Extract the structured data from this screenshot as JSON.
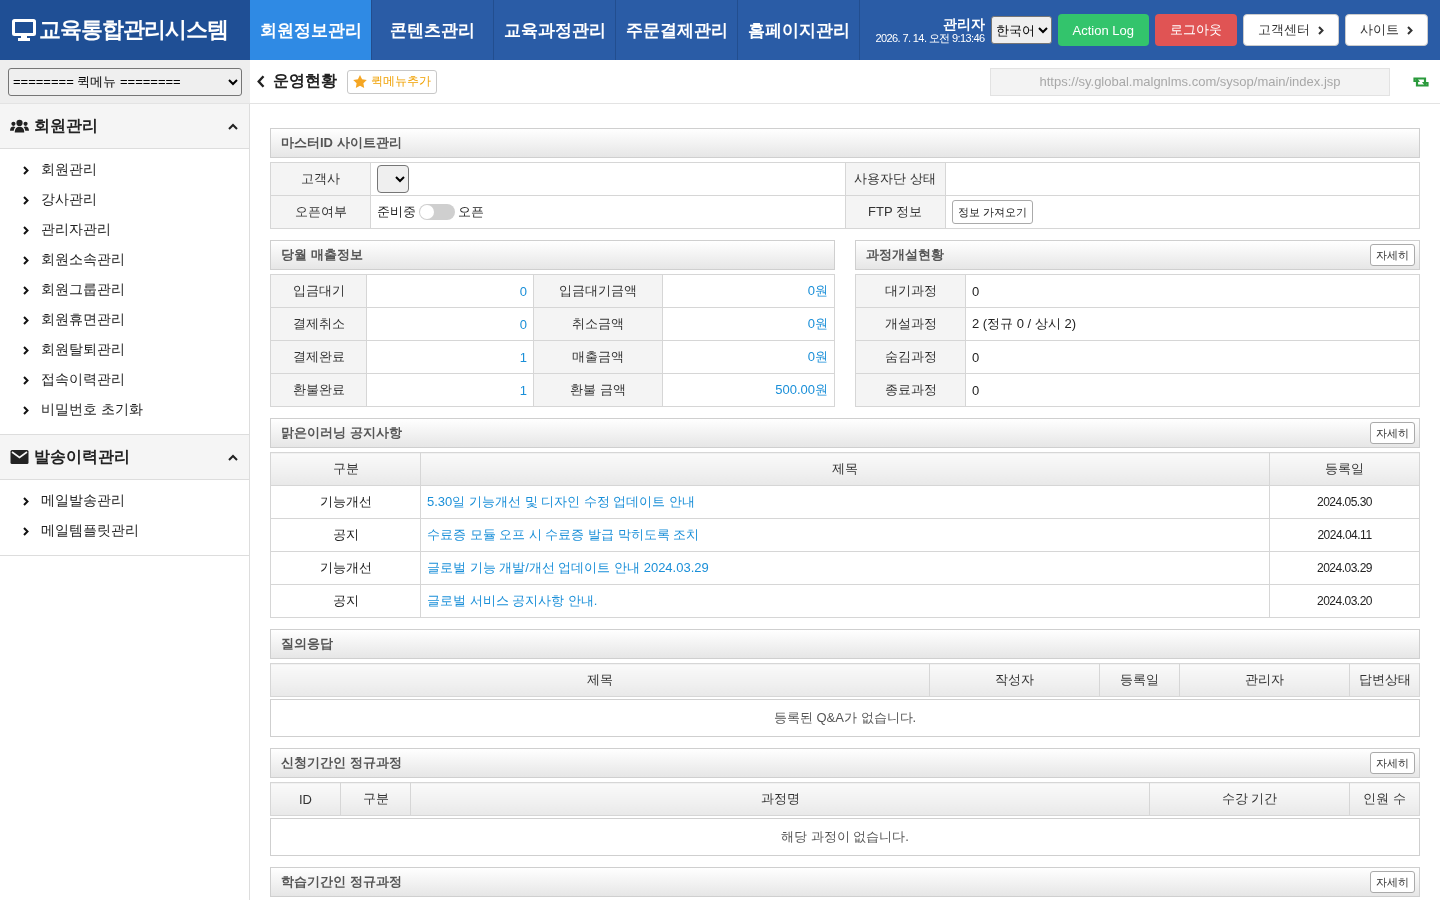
{
  "header": {
    "logo": "교육통합관리시스템",
    "nav": [
      {
        "label": "회원정보관리",
        "selected": true
      },
      {
        "label": "콘텐츠관리",
        "selected": false
      },
      {
        "label": "교육과정관리",
        "selected": false
      },
      {
        "label": "주문결제관리",
        "selected": false
      },
      {
        "label": "홈페이지관리",
        "selected": false
      }
    ],
    "user": {
      "role": "관리자",
      "datetime": "2026. 7. 14. 오전 9:13:46"
    },
    "language": "한국어",
    "buttons": [
      {
        "label": "Action Log",
        "kind": "green"
      },
      {
        "label": "로그아웃",
        "kind": "red"
      },
      {
        "label": "고객센터",
        "kind": "link"
      },
      {
        "label": "사이트",
        "kind": "link"
      }
    ]
  },
  "toolbar": {
    "quick_menu": "======== 퀵메뉴 ========",
    "page_title": "운영현황",
    "add_quick_menu": "퀵메뉴추가",
    "url": "https://sy.global.malgnlms.com/sysop/main/index.jsp"
  },
  "sidebar": {
    "groups": [
      {
        "title": "회원관리",
        "kind": "users",
        "expanded": true,
        "items": [
          "회원관리",
          "강사관리",
          "관리자관리",
          "회원소속관리",
          "회원그룹관리",
          "회원휴면관리",
          "회원탈퇴관리",
          "접속이력관리",
          "비밀번호 초기화"
        ]
      },
      {
        "title": "발송이력관리",
        "kind": "mail",
        "expanded": true,
        "items": [
          "메일발송관리",
          "메일템플릿관리"
        ]
      }
    ]
  },
  "master_site": {
    "title": "마스터ID 사이트관리",
    "client": {
      "label": "고객사"
    },
    "user_status": {
      "label": "사용자단 상태"
    },
    "open_status": {
      "label": "오픈여부",
      "off_label": "준비중",
      "on_label": "오픈",
      "on": false
    },
    "ftp": {
      "label": "FTP 정보",
      "button": "정보 가져오기"
    }
  },
  "monthly_sales": {
    "title": "당월 매출정보",
    "rows": [
      {
        "label": "입금대기",
        "value": "0",
        "amount_label": "입금대기금액",
        "amount": "0원"
      },
      {
        "label": "결제취소",
        "value": "0",
        "amount_label": "취소금액",
        "amount": "0원"
      },
      {
        "label": "결제완료",
        "value": "1",
        "amount_label": "매출금액",
        "amount": "0원"
      },
      {
        "label": "환불완료",
        "value": "1",
        "amount_label": "환불 금액",
        "amount": "500.00원"
      }
    ]
  },
  "course_status": {
    "title": "과정개설현황",
    "detail_button": "자세히",
    "rows": [
      {
        "label": "대기과정",
        "value": "0"
      },
      {
        "label": "개설과정",
        "value": "2 (정규 0 / 상시 2)"
      },
      {
        "label": "숨김과정",
        "value": "0"
      },
      {
        "label": "종료과정",
        "value": "0"
      }
    ]
  },
  "notices": {
    "title": "맑은이러닝 공지사항",
    "detail_button": "자세히",
    "columns": [
      "구분",
      "제목",
      "등록일"
    ],
    "rows": [
      {
        "category": "기능개선",
        "title": "5.30일 기능개선 및 디자인 수정 업데이트 안내",
        "date": "2024.05.30"
      },
      {
        "category": "공지",
        "title": "수료증 모듈 오프 시 수료증 발급 막히도록 조치",
        "date": "2024.04.11"
      },
      {
        "category": "기능개선",
        "title": "글로벌 기능 개발/개선 업데이트 안내 2024.03.29",
        "date": "2024.03.29"
      },
      {
        "category": "공지",
        "title": "글로벌 서비스 공지사항 안내.",
        "date": "2024.03.20"
      }
    ]
  },
  "qna": {
    "title": "질의응답",
    "columns": [
      "제목",
      "작성자",
      "등록일",
      "관리자",
      "답변상태"
    ],
    "empty_message": "등록된 Q&A가 없습니다."
  },
  "application_courses": {
    "title": "신청기간인 정규과정",
    "detail_button": "자세히",
    "columns": [
      "ID",
      "구분",
      "과정명",
      "수강 기간",
      "인원 수"
    ],
    "empty_message": "해당 과정이 없습니다."
  },
  "learning_courses": {
    "title": "학습기간인 정규과정",
    "detail_button": "자세히"
  }
}
